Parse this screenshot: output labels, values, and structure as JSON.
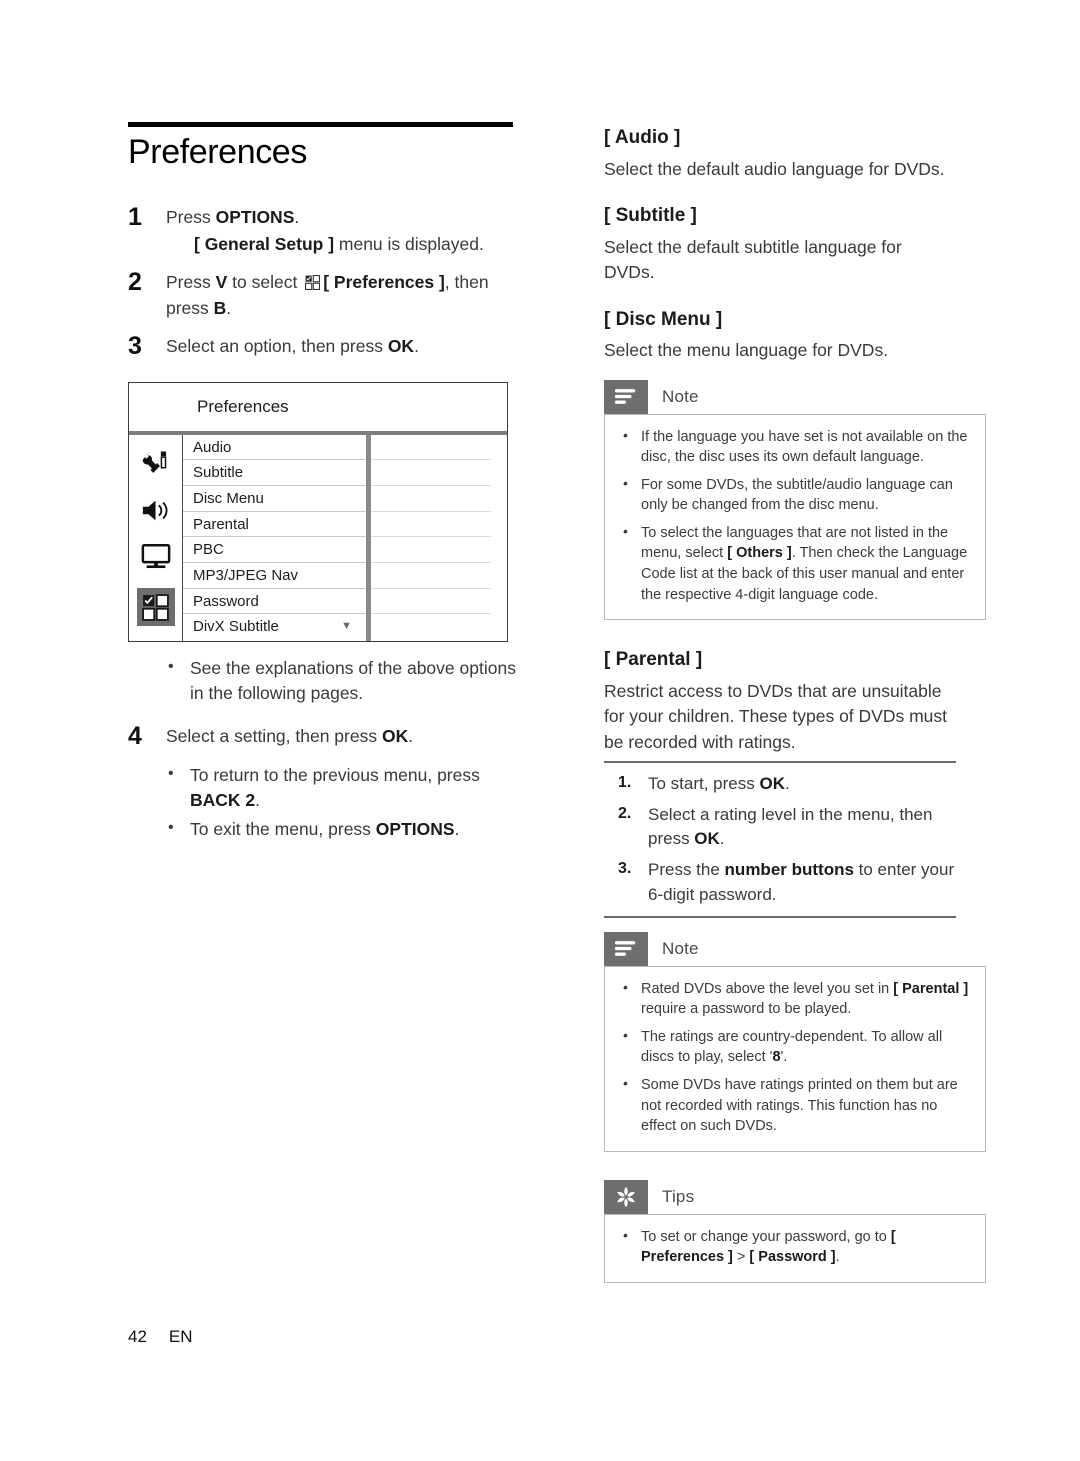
{
  "page": {
    "title": "Preferences",
    "footer_page_number": "42",
    "footer_language": "EN"
  },
  "steps": [
    {
      "num": "1",
      "text_before": "Press ",
      "bold": "OPTIONS",
      "text_after": ".",
      "sub_bold": "[ General Setup ]",
      "sub_after": " menu is displayed."
    },
    {
      "num": "2",
      "text_before": "Press ",
      "bold": "V",
      "text_mid": " to select ",
      "icon": "grid-2x2-check-icon",
      "bold2": "[ Preferences ]",
      "text_after": ", then press ",
      "bold3": "B",
      "text_end": "."
    },
    {
      "num": "3",
      "text_before": "Select an option, then press ",
      "bold": "OK",
      "text_after": "."
    },
    {
      "num": "4",
      "text_before": "Select a setting, then press ",
      "bold": "OK",
      "text_after": "."
    }
  ],
  "screen": {
    "header_label": "Preferences",
    "rail_icons": [
      {
        "name": "tools-settings-icon",
        "selected": false
      },
      {
        "name": "speaker-audio-icon",
        "selected": false
      },
      {
        "name": "monitor-video-icon",
        "selected": false
      },
      {
        "name": "grid-preferences-icon",
        "selected": true
      }
    ],
    "rows": [
      {
        "label": "Audio",
        "caret": ""
      },
      {
        "label": "Subtitle",
        "caret": ""
      },
      {
        "label": "Disc Menu",
        "caret": ""
      },
      {
        "label": "Parental",
        "caret": ""
      },
      {
        "label": "PBC",
        "caret": ""
      },
      {
        "label": "MP3/JPEG Nav",
        "caret": ""
      },
      {
        "label": "Password",
        "caret": ""
      },
      {
        "label": "DivX Subtitle",
        "caret": "▼"
      }
    ]
  },
  "left_bullets_after_screen": [
    "See the explanations of the above options in the following pages."
  ],
  "step4_bullets": [
    {
      "text": "To return to the previous menu, press ",
      "bold": "BACK  2",
      "after": "."
    },
    {
      "text": "To exit the menu, press ",
      "bold": "OPTIONS",
      "after": "."
    }
  ],
  "right": {
    "sections": [
      {
        "heading": "[ Audio ]",
        "body": "Select the default audio language for DVDs."
      },
      {
        "heading": "[ Subtitle ]",
        "body": "Select the default subtitle language for DVDs."
      },
      {
        "heading": "[ Disc Menu ]",
        "body": "Select the menu language for DVDs."
      }
    ],
    "note1": {
      "icon": "note-lines-icon",
      "title": "Note",
      "items": [
        {
          "parts": [
            {
              "t": "If the language you have set is not available on the disc, the disc uses its own default language.",
              "b": false
            }
          ]
        },
        {
          "parts": [
            {
              "t": "For some DVDs, the subtitle/audio language can only be changed from the disc menu.",
              "b": false
            }
          ]
        },
        {
          "parts": [
            {
              "t": "To select the languages that are not listed in the menu, select ",
              "b": false
            },
            {
              "t": "[ Others ]",
              "b": true
            },
            {
              "t": ".  Then check the Language Code list at the back of this user manual and enter the respective 4-digit language code.",
              "b": false
            }
          ]
        }
      ]
    },
    "parental": {
      "heading": "[ Parental ]",
      "body": "Restrict access to DVDs that are unsuitable for your children.  These types of DVDs must be recorded with ratings.",
      "procedure": [
        {
          "num": "1.",
          "parts": [
            {
              "t": "To start, press ",
              "b": false
            },
            {
              "t": "OK",
              "b": true
            },
            {
              "t": ".",
              "b": false
            }
          ]
        },
        {
          "num": "2.",
          "parts": [
            {
              "t": "Select a rating level in the menu, then press ",
              "b": false
            },
            {
              "t": "OK",
              "b": true
            },
            {
              "t": ".",
              "b": false
            }
          ]
        },
        {
          "num": "3.",
          "parts": [
            {
              "t": "Press the ",
              "b": false
            },
            {
              "t": "number buttons",
              "b": true
            },
            {
              "t": " to enter your 6-digit password.",
              "b": false
            }
          ]
        }
      ]
    },
    "note2": {
      "icon": "note-lines-icon",
      "title": "Note",
      "items": [
        {
          "parts": [
            {
              "t": "Rated DVDs above the level you set in ",
              "b": false
            },
            {
              "t": "[ Parental ]",
              "b": true
            },
            {
              "t": " require a password to be played.",
              "b": false
            }
          ]
        },
        {
          "parts": [
            {
              "t": "The ratings are country-dependent. To allow all discs to play, select '",
              "b": false
            },
            {
              "t": "8",
              "b": true
            },
            {
              "t": "'.",
              "b": false
            }
          ]
        },
        {
          "parts": [
            {
              "t": "Some DVDs have ratings printed on them but are not recorded with ratings.  This function has no effect on such DVDs.",
              "b": false
            }
          ]
        }
      ]
    },
    "tips": {
      "icon": "tips-asterisk-icon",
      "title": "Tips",
      "items": [
        {
          "parts": [
            {
              "t": "To set or change your password, go to ",
              "b": false
            },
            {
              "t": "[ Preferences ]",
              "b": true
            },
            {
              "t": " > ",
              "b": false
            },
            {
              "t": "[ Password ]",
              "b": true
            },
            {
              "t": ".",
              "b": false
            }
          ]
        }
      ]
    }
  },
  "colors": {
    "callout_icon_bg": "#6e6e6e",
    "callout_border": "#b9b9b9",
    "title_rule": "#000000",
    "screen_divider": "#8a8a8a"
  }
}
